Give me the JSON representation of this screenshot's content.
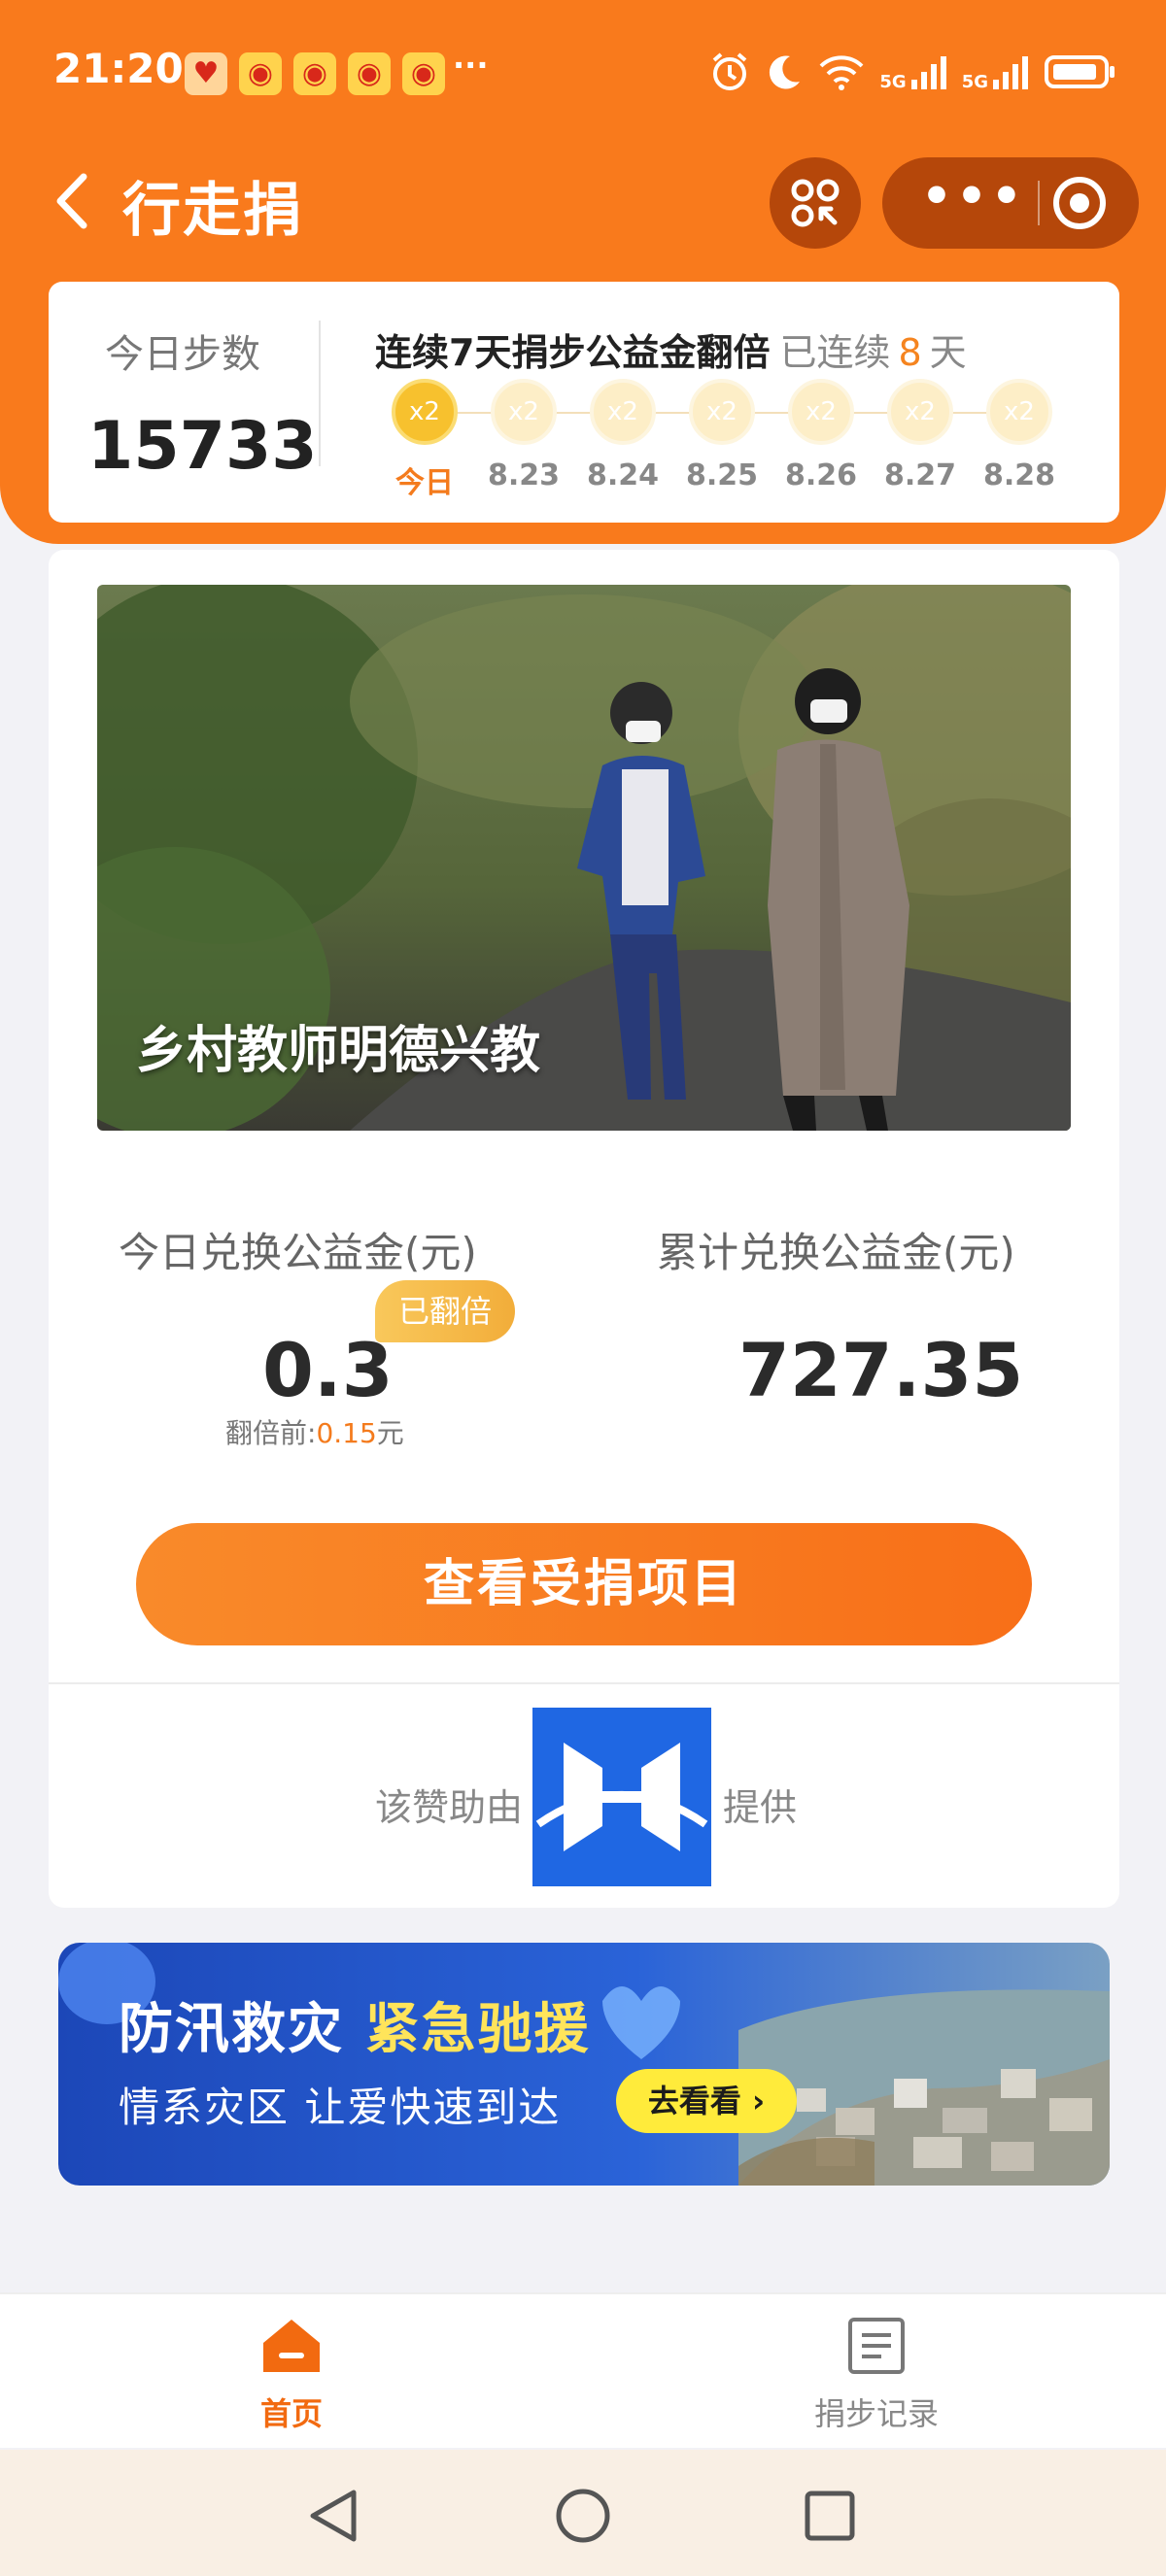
{
  "status_bar": {
    "time": "21:20",
    "notification_icons": [
      "heart-icon",
      "weibo-icon",
      "weibo-icon",
      "weibo-icon",
      "weibo-icon"
    ],
    "more": "···",
    "network_1": "5G",
    "network_2": "5G",
    "system_icons": [
      "alarm-icon",
      "moon-icon",
      "wifi-icon",
      "signal-icon",
      "signal-icon",
      "battery-icon"
    ]
  },
  "header": {
    "title": "行走捐",
    "back_icon": "chevron-left-icon",
    "scan_icon": "scan-icon",
    "more_icon": "more-dots-icon",
    "close_icon": "target-circle-icon"
  },
  "steps": {
    "label": "今日步数",
    "count": "15733"
  },
  "streak": {
    "title": "连续7天捐步公益金翻倍",
    "prefix": "已连续",
    "days": "8",
    "unit": "天",
    "items": [
      {
        "coin": "x2",
        "label": "今日",
        "active": true
      },
      {
        "coin": "x2",
        "label": "8.23",
        "active": false
      },
      {
        "coin": "x2",
        "label": "8.24",
        "active": false
      },
      {
        "coin": "x2",
        "label": "8.25",
        "active": false
      },
      {
        "coin": "x2",
        "label": "8.26",
        "active": false
      },
      {
        "coin": "x2",
        "label": "8.27",
        "active": false
      },
      {
        "coin": "x2",
        "label": "8.28",
        "active": false
      }
    ]
  },
  "project": {
    "caption": "乡村教师明德兴教"
  },
  "stats": {
    "today_label": "今日兑换公益金(元)",
    "doubled_badge": "已翻倍",
    "today_value": "0.3",
    "before_prefix": "翻倍前:",
    "before_value": "0.15",
    "before_unit": "元",
    "total_label": "累计兑换公益金(元)",
    "total_value": "727.35"
  },
  "actions": {
    "view_projects": "查看受捐项目"
  },
  "sponsor": {
    "prefix": "该赞助由",
    "suffix": "提供"
  },
  "banner": {
    "line1_a": "防汛救灾",
    "line1_b": "紧急驰援",
    "line2": "情系灾区 让爱快速到达",
    "button": "去看看",
    "button_arrow": "›"
  },
  "tabs": [
    {
      "label": "首页",
      "icon": "home-icon",
      "active": true
    },
    {
      "label": "捐步记录",
      "icon": "record-list-icon",
      "active": false
    }
  ],
  "system_nav": [
    "back-triangle-icon",
    "home-circle-icon",
    "recents-square-icon"
  ],
  "colors": {
    "brand_orange": "#f97a1c",
    "accent_orange": "#f47b1d",
    "coin_gold": "#f7c12e",
    "sponsor_blue": "#1f67e3",
    "banner_button": "#ffeb3b"
  }
}
